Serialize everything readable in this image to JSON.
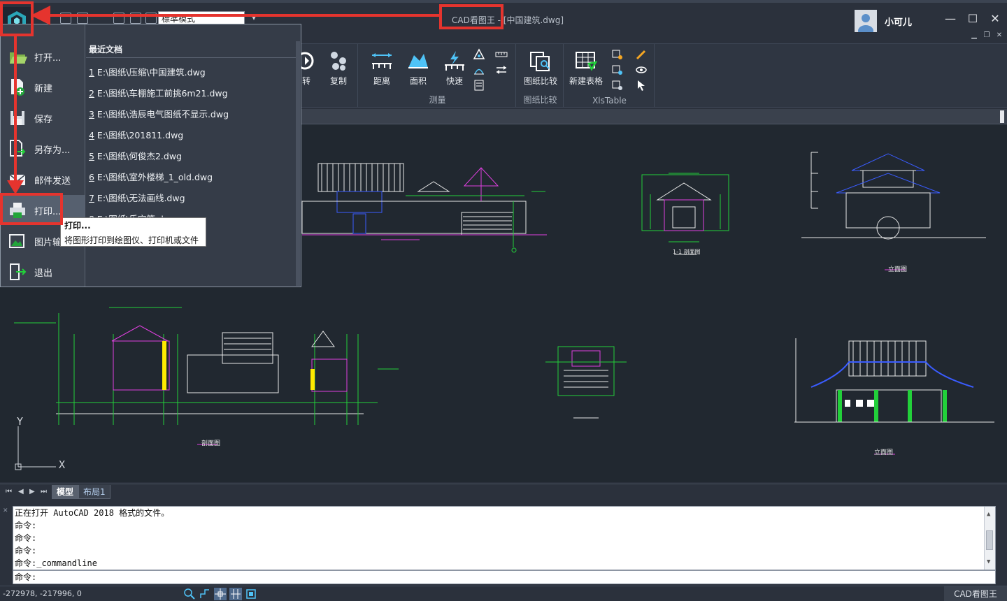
{
  "titlebar": {
    "mode_value": "標準模式",
    "title": "CAD看图王 - [中国建筑.dwg]",
    "user_name": "小可儿",
    "minimize": "—",
    "maximize": "☐",
    "close": "✕"
  },
  "ribbon": {
    "groups": [
      {
        "label": "",
        "buttons": [
          {
            "label": "转",
            "icon": "rotate-icon"
          },
          {
            "label": "复制",
            "icon": "copy-icon"
          }
        ]
      },
      {
        "label": "测量",
        "buttons": [
          {
            "label": "距离",
            "icon": "distance-icon"
          },
          {
            "label": "面积",
            "icon": "area-icon"
          },
          {
            "label": "快速",
            "icon": "quick-measure-icon"
          }
        ]
      },
      {
        "label": "图纸比较",
        "buttons": [
          {
            "label": "图纸比较",
            "icon": "compare-icon"
          }
        ]
      },
      {
        "label": "XlsTable",
        "buttons": [
          {
            "label": "新建表格",
            "icon": "new-table-icon"
          }
        ]
      }
    ]
  },
  "app_menu": {
    "items": [
      {
        "label": "打开...",
        "icon": "open-folder-icon"
      },
      {
        "label": "新建",
        "icon": "new-file-icon"
      },
      {
        "label": "保存",
        "icon": "save-icon"
      },
      {
        "label": "另存为...",
        "icon": "save-as-icon"
      },
      {
        "label": "邮件发送",
        "icon": "mail-icon"
      },
      {
        "label": "打印...",
        "icon": "print-icon"
      },
      {
        "label": "图片输",
        "icon": "image-export-icon"
      },
      {
        "label": "退出",
        "icon": "exit-icon"
      }
    ],
    "recent_title": "最近文档",
    "recent": [
      {
        "num": "1",
        "path": " E:\\图纸\\压缩\\中国建筑.dwg"
      },
      {
        "num": "2",
        "path": " E:\\图纸\\车棚施工前挑6m21.dwg"
      },
      {
        "num": "3",
        "path": " E:\\图纸\\浩辰电气图纸不显示.dwg"
      },
      {
        "num": "4",
        "path": " E:\\图纸\\201811.dwg"
      },
      {
        "num": "5",
        "path": " E:\\图纸\\何俊杰2.dwg"
      },
      {
        "num": "6",
        "path": " E:\\图纸\\室外楼梯_1_old.dwg"
      },
      {
        "num": "7",
        "path": " E:\\图纸\\无法画线.dwg"
      },
      {
        "num": "8",
        "path": " E:\\图纸\\乐宝箱.dwg"
      }
    ]
  },
  "tooltip": {
    "title": "打印...",
    "description": "将图形打印到绘图仪、打印机或文件"
  },
  "canvas": {
    "drawing_labels": [
      "立面图",
      "立面图",
      "剖面图",
      "1-1 剖面图"
    ],
    "ucs_x": "X",
    "ucs_y": "Y"
  },
  "sheet_tabs": [
    {
      "label": "模型",
      "active": true
    },
    {
      "label": "布局1",
      "active": false
    }
  ],
  "command": {
    "log": [
      "正在打开 AutoCAD 2018 格式的文件。",
      "命令:",
      "命令:",
      "命令:",
      "命令:_commandline"
    ],
    "prompt": "命令:"
  },
  "status": {
    "coords": "-272978, -217996, 0",
    "brand": "CAD看图王"
  },
  "colors": {
    "annotation": "#e5342e",
    "drawing_white": "#e8e8e8",
    "drawing_green": "#22d03a",
    "drawing_magenta": "#e040e0",
    "drawing_blue": "#3a5cff"
  }
}
